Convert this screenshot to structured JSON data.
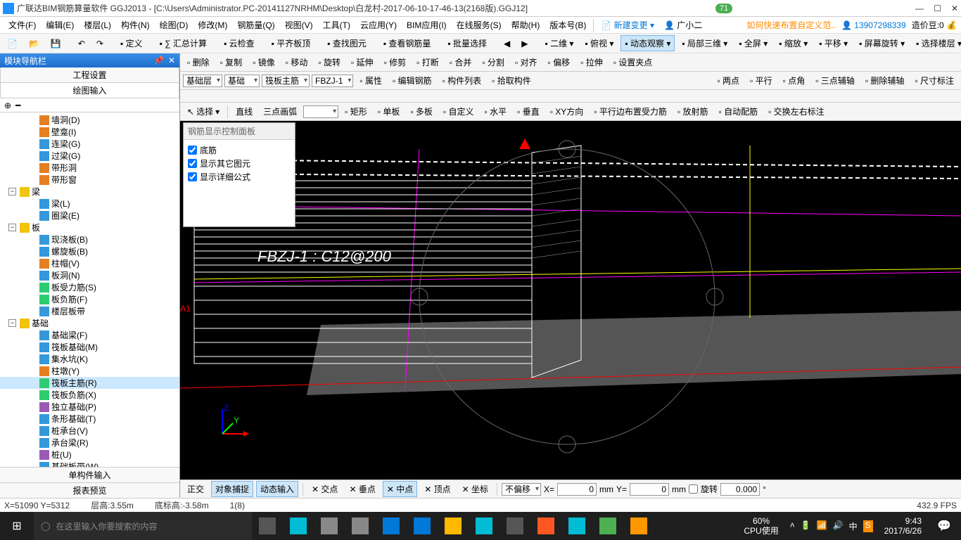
{
  "title": "广联达BIM钢筋算量软件 GGJ2013 - [C:\\Users\\Administrator.PC-20141127NRHM\\Desktop\\白龙村-2017-06-10-17-46-13(2168版).GGJ12]",
  "badge": "71",
  "menus": [
    "文件(F)",
    "编辑(E)",
    "楼层(L)",
    "构件(N)",
    "绘图(D)",
    "修改(M)",
    "钢筋量(Q)",
    "视图(V)",
    "工具(T)",
    "云应用(Y)",
    "BIM应用(I)",
    "在线服务(S)",
    "帮助(H)",
    "版本号(B)"
  ],
  "menu_right": {
    "new": "新建变更",
    "user": "广小二",
    "tip": "如何快速布置自定义范..",
    "phone": "13907298339",
    "coin": "造价豆:0"
  },
  "toolbar1": [
    "定义",
    "∑ 汇总计算",
    "云检查",
    "平齐板顶",
    "查找图元",
    "查看钢筋量",
    "批量选择"
  ],
  "toolbar1_view": [
    "二维",
    "俯视",
    "动态观察",
    "局部三维",
    "全屏",
    "缩放",
    "平移",
    "屏幕旋转",
    "选择楼层"
  ],
  "left": {
    "header": "模块导航栏",
    "tabs": [
      "工程设置",
      "绘图输入"
    ],
    "bottom_tabs": [
      "单构件输入",
      "报表预览"
    ]
  },
  "tree": [
    {
      "d": 2,
      "i": "#e67e22",
      "t": "墙洞(D)"
    },
    {
      "d": 2,
      "i": "#e67e22",
      "t": "壁龛(I)"
    },
    {
      "d": 2,
      "i": "#3498db",
      "t": "连梁(G)"
    },
    {
      "d": 2,
      "i": "#3498db",
      "t": "过梁(G)"
    },
    {
      "d": 2,
      "i": "#e67e22",
      "t": "带形洞"
    },
    {
      "d": 2,
      "i": "#e67e22",
      "t": "带形窗"
    },
    {
      "d": 0,
      "exp": "-",
      "i": "#f1c40f",
      "t": "梁"
    },
    {
      "d": 2,
      "i": "#3498db",
      "t": "梁(L)"
    },
    {
      "d": 2,
      "i": "#3498db",
      "t": "圈梁(E)"
    },
    {
      "d": 0,
      "exp": "-",
      "i": "#f1c40f",
      "t": "板"
    },
    {
      "d": 2,
      "i": "#3498db",
      "t": "现浇板(B)"
    },
    {
      "d": 2,
      "i": "#3498db",
      "t": "螺旋板(B)"
    },
    {
      "d": 2,
      "i": "#e67e22",
      "t": "柱帽(V)"
    },
    {
      "d": 2,
      "i": "#3498db",
      "t": "板洞(N)"
    },
    {
      "d": 2,
      "i": "#2ecc71",
      "t": "板受力筋(S)"
    },
    {
      "d": 2,
      "i": "#2ecc71",
      "t": "板负筋(F)"
    },
    {
      "d": 2,
      "i": "#3498db",
      "t": "楼层板带"
    },
    {
      "d": 0,
      "exp": "-",
      "i": "#f1c40f",
      "t": "基础"
    },
    {
      "d": 2,
      "i": "#3498db",
      "t": "基础梁(F)"
    },
    {
      "d": 2,
      "i": "#3498db",
      "t": "筏板基础(M)"
    },
    {
      "d": 2,
      "i": "#3498db",
      "t": "集水坑(K)"
    },
    {
      "d": 2,
      "i": "#e67e22",
      "t": "柱墩(Y)"
    },
    {
      "d": 2,
      "i": "#2ecc71",
      "t": "筏板主筋(R)",
      "sel": true
    },
    {
      "d": 2,
      "i": "#2ecc71",
      "t": "筏板负筋(X)"
    },
    {
      "d": 2,
      "i": "#9b59b6",
      "t": "独立基础(P)"
    },
    {
      "d": 2,
      "i": "#3498db",
      "t": "条形基础(T)"
    },
    {
      "d": 2,
      "i": "#3498db",
      "t": "桩承台(V)"
    },
    {
      "d": 2,
      "i": "#3498db",
      "t": "承台梁(R)"
    },
    {
      "d": 2,
      "i": "#9b59b6",
      "t": "桩(U)"
    },
    {
      "d": 2,
      "i": "#3498db",
      "t": "基础板带(W)"
    }
  ],
  "edit_bar": [
    "删除",
    "复制",
    "镜像",
    "移动",
    "旋转",
    "延伸",
    "修剪",
    "打断",
    "合并",
    "分割",
    "对齐",
    "偏移",
    "拉伸",
    "设置夹点"
  ],
  "sel_bar": {
    "layer": "基础层",
    "type": "基础",
    "sub": "筏板主筋",
    "item": "FBZJ-1",
    "btns": [
      "属性",
      "编辑钢筋",
      "构件列表",
      "拾取构件"
    ],
    "right": [
      "两点",
      "平行",
      "点角",
      "三点辅轴",
      "删除辅轴",
      "尺寸标注"
    ]
  },
  "draw_bar": {
    "sel": "选择",
    "items": [
      "直线",
      "三点画弧"
    ],
    "btns": [
      "矩形",
      "单板",
      "多板",
      "自定义",
      "水平",
      "垂直",
      "XY方向",
      "平行边布置受力筋",
      "放射筋",
      "自动配筋",
      "交换左右标注"
    ]
  },
  "float": {
    "title": "钢筋显示控制面板",
    "opts": [
      "底筋",
      "显示其它图元",
      "显示详细公式"
    ]
  },
  "vp_text": "FBZJ-1 : C12@200",
  "marker": "A1",
  "snap_bar": {
    "btns": [
      "正交",
      "对象捕捉",
      "动态输入"
    ],
    "pts": [
      "交点",
      "垂点",
      "中点",
      "顶点",
      "坐标"
    ],
    "offset": "不偏移",
    "x": "0",
    "y": "0",
    "rot_lbl": "旋转",
    "rot": "0.000",
    "mm": "mm",
    "xl": "X=",
    "yl": "Y="
  },
  "status": {
    "coord": "X=51090 Y=5312",
    "floor": "层高:3.55m",
    "base": "底标高:-3.58m",
    "sel": "1(8)",
    "fps": "432.9 FPS"
  },
  "taskbar": {
    "search": "在这里输入你要搜索的内容",
    "cpu1": "60%",
    "cpu2": "CPU使用",
    "time": "9:43",
    "date": "2017/6/26",
    "ime": "中"
  }
}
